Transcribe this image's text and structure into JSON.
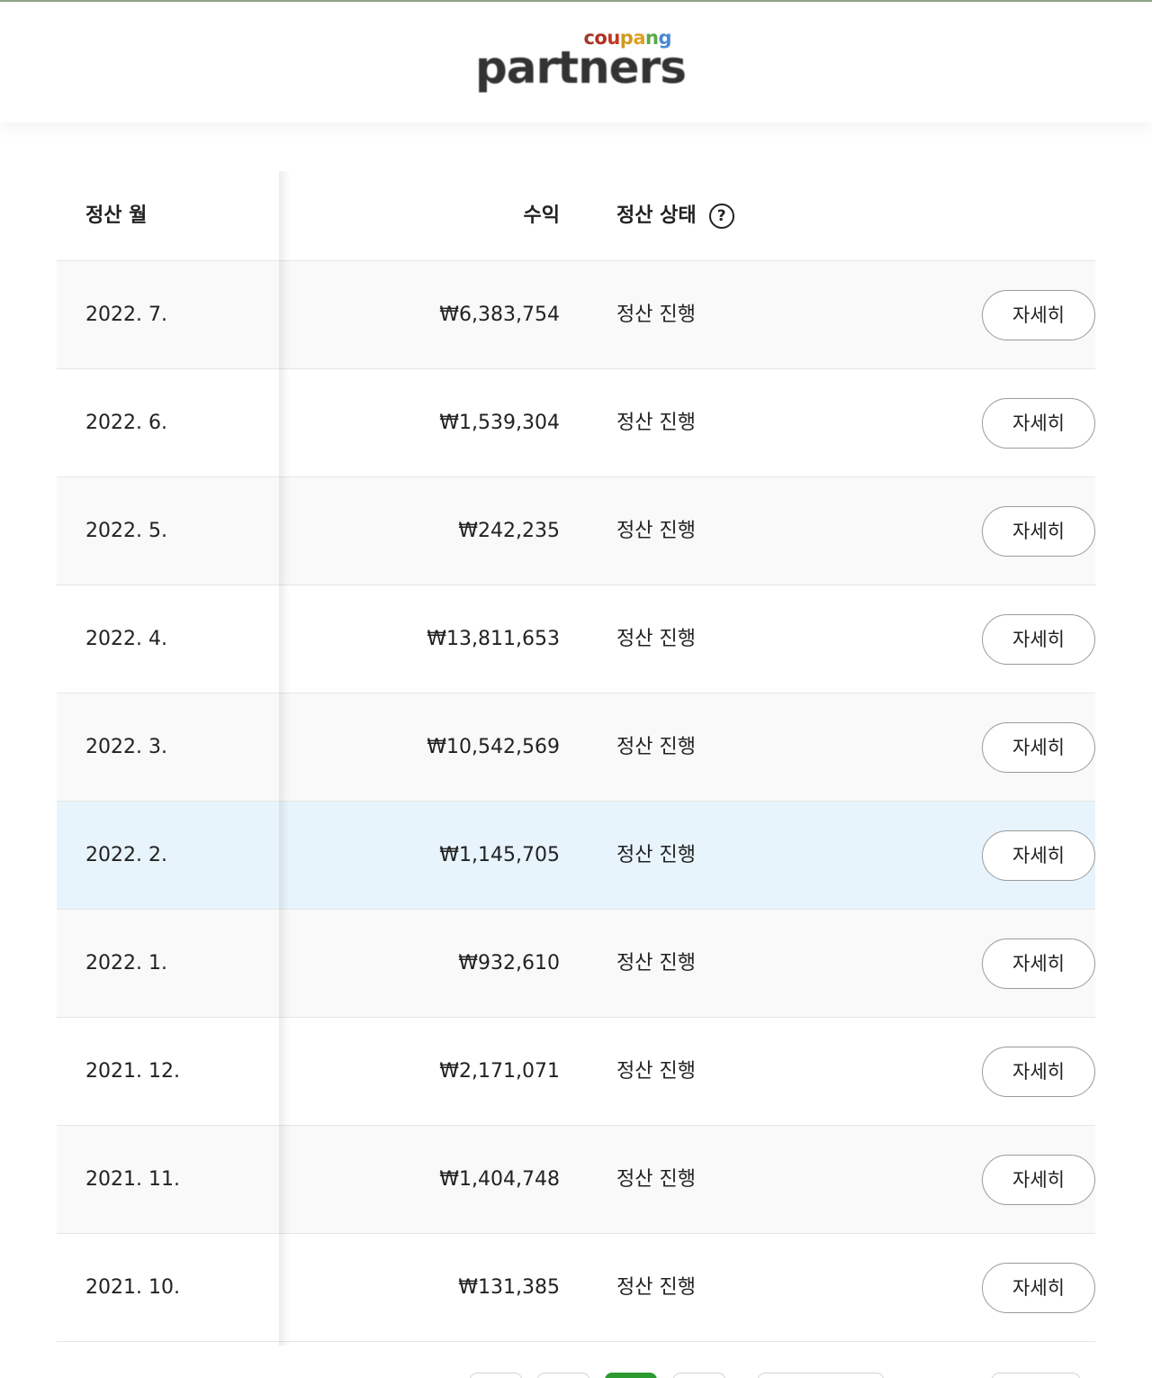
{
  "brand": {
    "coupang_letters": [
      {
        "ch": "c",
        "color": "#a03a2a"
      },
      {
        "ch": "o",
        "color": "#b03020"
      },
      {
        "ch": "u",
        "color": "#c03a24"
      },
      {
        "ch": "p",
        "color": "#d09a20"
      },
      {
        "ch": "a",
        "color": "#e0a020"
      },
      {
        "ch": "n",
        "color": "#5aa84a"
      },
      {
        "ch": "g",
        "color": "#4a8ad0"
      }
    ],
    "partners": "partners"
  },
  "table": {
    "headers": {
      "month": "정산 월",
      "income": "수익",
      "status": "정산 상태",
      "help_icon": "?"
    },
    "rows": [
      {
        "month": "2022. 7.",
        "income": "₩6,383,754",
        "status": "정산 진행",
        "action": "자세히"
      },
      {
        "month": "2022. 6.",
        "income": "₩1,539,304",
        "status": "정산 진행",
        "action": "자세히"
      },
      {
        "month": "2022. 5.",
        "income": "₩242,235",
        "status": "정산 진행",
        "action": "자세히"
      },
      {
        "month": "2022. 4.",
        "income": "₩13,811,653",
        "status": "정산 진행",
        "action": "자세히"
      },
      {
        "month": "2022. 3.",
        "income": "₩10,542,569",
        "status": "정산 진행",
        "action": "자세히"
      },
      {
        "month": "2022. 2.",
        "income": "₩1,145,705",
        "status": "정산 진행",
        "action": "자세히"
      },
      {
        "month": "2022. 1.",
        "income": "₩932,610",
        "status": "정산 진행",
        "action": "자세히"
      },
      {
        "month": "2021. 12.",
        "income": "₩2,171,071",
        "status": "정산 진행",
        "action": "자세히"
      },
      {
        "month": "2021. 11.",
        "income": "₩1,404,748",
        "status": "정산 진행",
        "action": "자세히"
      },
      {
        "month": "2021. 10.",
        "income": "₩131,385",
        "status": "정산 진행",
        "action": "자세히"
      }
    ],
    "highlight_row_month": "2022. 2."
  },
  "colors": {
    "highlight_row": "#e8f4fc",
    "pagination_active": "#2c9a2f"
  }
}
